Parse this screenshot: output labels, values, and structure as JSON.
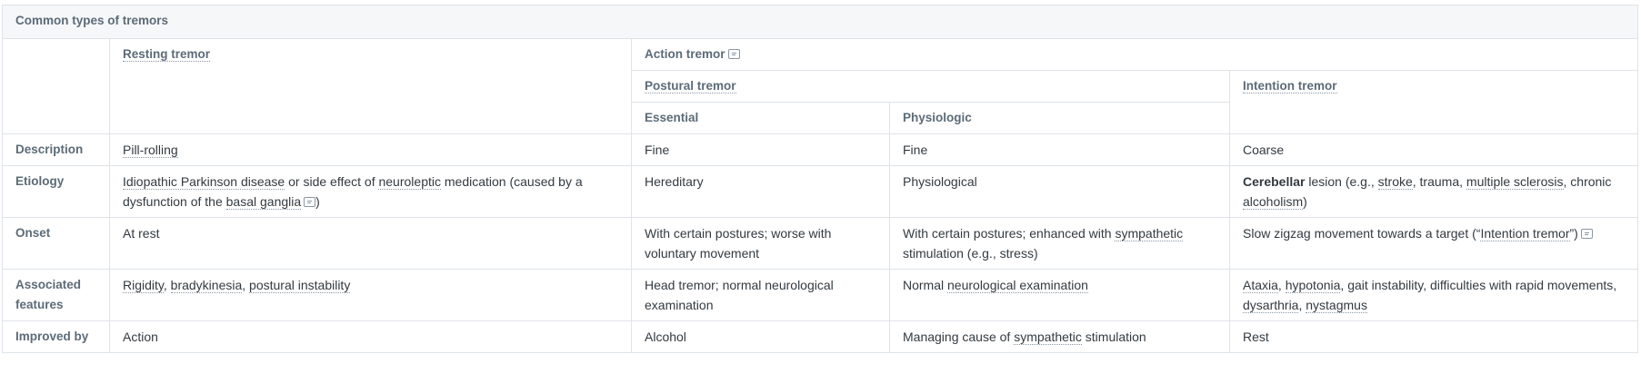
{
  "table": {
    "caption": "Common types of tremors",
    "headers": {
      "resting": "Resting tremor",
      "action": "Action tremor",
      "postural": "Postural tremor",
      "intention": "Intention tremor",
      "essential": "Essential",
      "physiologic": "Physiologic"
    },
    "rows": {
      "description": {
        "label": "Description",
        "resting": "Pill-rolling",
        "essential": "Fine",
        "physiologic": "Fine",
        "intention": "Coarse"
      },
      "etiology": {
        "label": "Etiology",
        "resting": {
          "t1": "Idiopathic Parkinson disease",
          "t2": " or side effect of ",
          "t3": "neuroleptic",
          "t4": " medication (caused by a dysfunction of the ",
          "t5": "basal ganglia",
          "t6": ")"
        },
        "essential": "Hereditary",
        "physiologic": "Physiological",
        "intention": {
          "t1": "Cerebellar",
          "t2": " lesion (e.g., ",
          "t3": "stroke",
          "t4": ", trauma, ",
          "t5": "multiple sclerosis",
          "t6": ", chronic ",
          "t7": "alcoholism",
          "t8": ")"
        }
      },
      "onset": {
        "label": "Onset",
        "resting": "At rest",
        "essential": "With certain postures; worse with voluntary movement",
        "physiologic": {
          "t1": "With certain postures; enhanced with ",
          "t2": "sympathetic",
          "t3": " stimulation (e.g., stress)"
        },
        "intention": {
          "t1": "Slow zigzag movement towards a target (“",
          "t2": "Intention tremor",
          "t3": "”)"
        }
      },
      "associated": {
        "label": "Associated features",
        "resting": {
          "t1": "Rigidity",
          "t2": ", ",
          "t3": "bradykinesia",
          "t4": ", ",
          "t5": "postural instability"
        },
        "essential": "Head tremor; normal neurological examination",
        "physiologic": {
          "t1": "Normal ",
          "t2": "neurological examination"
        },
        "intention": {
          "t1": "Ataxia",
          "t2": ", ",
          "t3": "hypotonia",
          "t4": ", gait instability, difficulties with rapid movements, ",
          "t5": "dysarthria",
          "t6": ", ",
          "t7": "nystagmus"
        }
      },
      "improved": {
        "label": "Improved by",
        "resting": "Action",
        "essential": "Alcohol",
        "physiologic": {
          "t1": "Managing cause of ",
          "t2": "sympathetic",
          "t3": " stimulation"
        },
        "intention": "Rest"
      }
    }
  }
}
